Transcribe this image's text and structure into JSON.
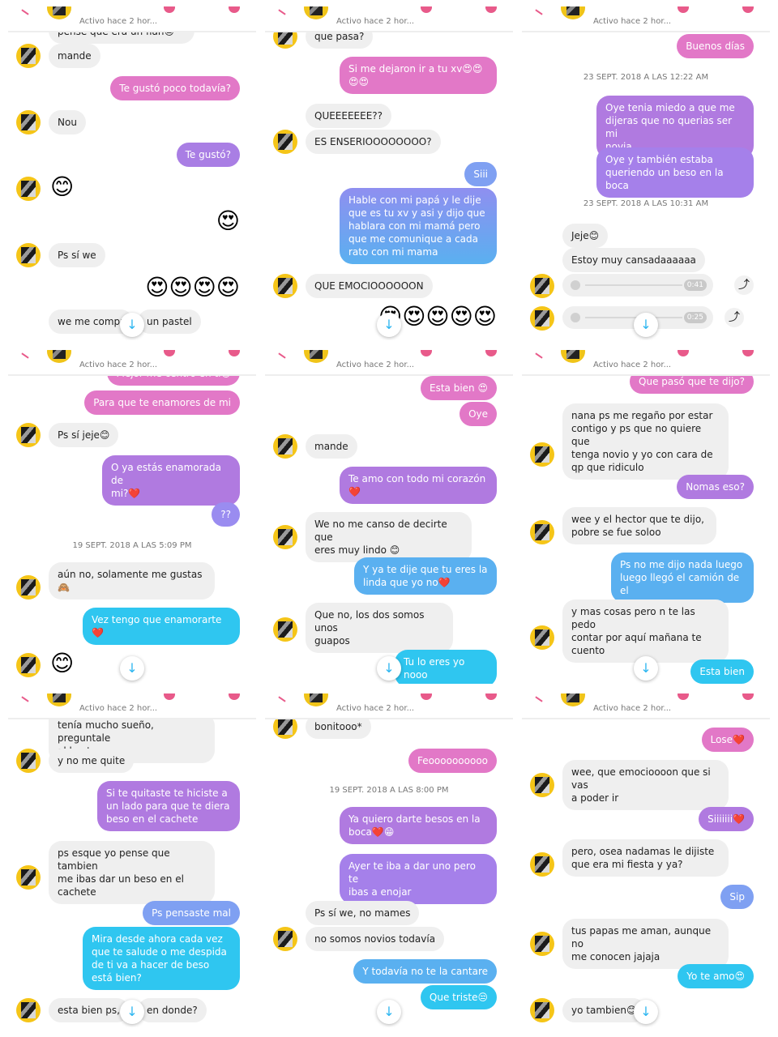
{
  "status_text": "Activo hace 2 hor...",
  "colors": {
    "pink": "#e278c7",
    "violet": "#b07ae0",
    "blue": "#5ab0f0",
    "cyan": "#2fc6f0",
    "incoming": "#efefef"
  },
  "panels": [
    {
      "messages": [
        {
          "t": "pensé que era un flan😒"
        },
        {
          "t": "mande"
        },
        {
          "t": "Te gustó poco todavía?"
        },
        {
          "t": "Nou"
        },
        {
          "t": "Te gustó?"
        },
        {
          "t": "😊"
        },
        {
          "t": "😍"
        },
        {
          "t": "Ps sí we"
        },
        {
          "t": "😍😍😍😍"
        },
        {
          "t": "we me compr"
        },
        {
          "t": "un pastel"
        }
      ]
    },
    {
      "messages": [
        {
          "t": "que pasa?"
        },
        {
          "t": "Si me dejaron ir a tu xv😍😍\n😍😍"
        },
        {
          "t": "QUEEEEEEE??"
        },
        {
          "t": "ES ENSERIOOOOOOOO?"
        },
        {
          "t": "Siii"
        },
        {
          "t": "Hable con mi papá y le dije\nque es tu xv y asi y dijo que\nhablara con mi mamá pero\nque me comunique a cada\nrato con mi mama"
        },
        {
          "t": "QUE EMOCIOOOOOON"
        },
        {
          "t": "😍😍😍😍😍"
        }
      ]
    },
    {
      "messages": [
        {
          "t": "Buenos días"
        },
        {
          "t": "23 SEPT. 2018 A LAS 12:22 AM"
        },
        {
          "t": "Oye tenia miedo a que me\ndijeras que no querias ser mi\nnovia"
        },
        {
          "t": "Oye y también estaba\nqueriendo un beso en la boca"
        },
        {
          "t": "23 SEPT. 2018 A LAS 10:31 AM"
        },
        {
          "t": "Jeje😊"
        },
        {
          "t": "Estoy muy cansadaaaaaa"
        },
        {
          "t": "0:41"
        },
        {
          "t": "0:25"
        }
      ]
    },
    {
      "messages": [
        {
          "t": "Mejor me centro en ti😁"
        },
        {
          "t": "Para que te enamores de mi"
        },
        {
          "t": "Ps sí jeje😊"
        },
        {
          "t": "O ya estás enamorada de\nmi?❤️"
        },
        {
          "t": "??"
        },
        {
          "t": "19 SEPT. 2018 A LAS 5:09 PM"
        },
        {
          "t": "aún no, solamente me gustas\n🙈"
        },
        {
          "t": "Vez tengo que enamorarte\n❤️"
        },
        {
          "t": "😊"
        }
      ]
    },
    {
      "messages": [
        {
          "t": "Esta bien 😍"
        },
        {
          "t": "Oye"
        },
        {
          "t": "mande"
        },
        {
          "t": "Te amo con todo mi corazón\n❤️"
        },
        {
          "t": "We no me canso de decirte que\neres muy lindo 😊"
        },
        {
          "t": "Y ya te dije que tu eres la\nlinda que yo no❤️"
        },
        {
          "t": "Que no, los dos somos unos\nguapos"
        },
        {
          "t": "Tu lo eres yo nooo"
        }
      ]
    },
    {
      "messages": [
        {
          "t": "Que pasó que te dijo?"
        },
        {
          "t": "nana ps me regaño por estar\ncontigo y ps que no quiere que\ntenga novio y yo con cara de\nqp que ridiculo"
        },
        {
          "t": "Nomas eso?"
        },
        {
          "t": "wee y el hector que te dijo,\npobre se fue soloo"
        },
        {
          "t": "Ps no me dijo nada luego\nluego llegó el camión de el"
        },
        {
          "t": "y mas cosas pero n te las pedo\ncontar por aquí mañana te\ncuento"
        },
        {
          "t": "Esta bien"
        }
      ]
    },
    {
      "messages": [
        {
          "t": "tenía mucho sueño, preguntale\nal hector"
        },
        {
          "t": "y no me quite"
        },
        {
          "t": "Si te quitaste te hiciste a\nun lado para que te diera\nbeso en el cachete"
        },
        {
          "t": "ps esque yo pense que tambien\nme ibas dar un beso en el\ncachete"
        },
        {
          "t": "Ps pensaste mal"
        },
        {
          "t": "Mira desde ahora cada vez\nque te salude o me despida\nde ti va a hacer de beso\nestá bien?"
        },
        {
          "t": "esta bien ps,"
        },
        {
          "t": "en donde?"
        }
      ]
    },
    {
      "messages": [
        {
          "t": "bonitooo*"
        },
        {
          "t": "Feoooooooooo"
        },
        {
          "t": "19 SEPT. 2018 A LAS 8:00 PM"
        },
        {
          "t": "Ya quiero darte besos en la\nboca❤️😁"
        },
        {
          "t": "Ayer te iba a dar uno pero te\nibas a enojar"
        },
        {
          "t": "Ps sí we, no mames"
        },
        {
          "t": "no somos novios todavía"
        },
        {
          "t": "Y todavía no te la cantare"
        },
        {
          "t": "Que triste😒"
        }
      ]
    },
    {
      "messages": [
        {
          "t": "Lose❤️"
        },
        {
          "t": "wee, que emocioooon que si vas\na poder ir"
        },
        {
          "t": "Siiiiiii❤️"
        },
        {
          "t": "pero, osea nadamas le dijiste\nque era mi fiesta y ya?"
        },
        {
          "t": "Sip"
        },
        {
          "t": "tus papas me aman, aunque no\nme conocen jajaja"
        },
        {
          "t": "Yo te amo😍"
        },
        {
          "t": "yo tambien😊"
        }
      ]
    }
  ]
}
